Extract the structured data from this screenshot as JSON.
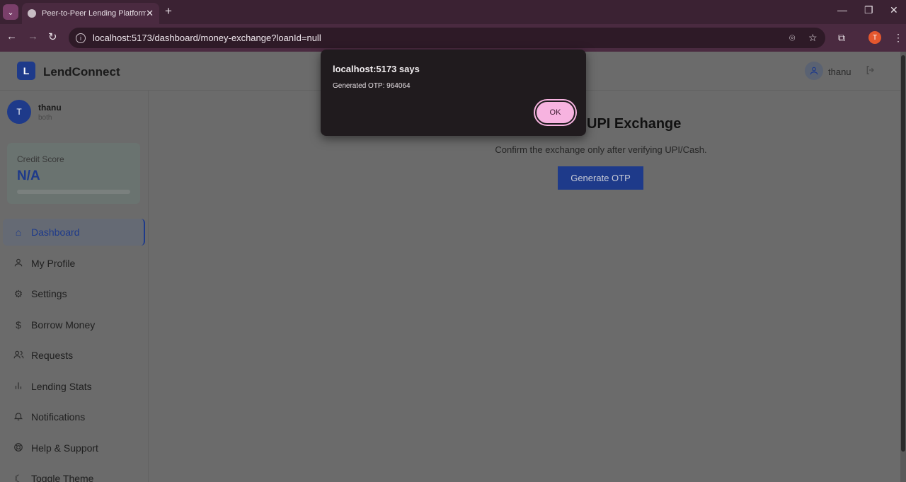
{
  "browser": {
    "tab_title": "Peer-to-Peer Lending Platform",
    "url": "localhost:5173/dashboard/money-exchange?loanId=null",
    "profile_initial": "T"
  },
  "header": {
    "logo_letter": "L",
    "brand": "LendConnect",
    "user_name": "thanu"
  },
  "sidebar": {
    "avatar_initial": "T",
    "user_name": "thanu",
    "user_role": "both",
    "credit_label": "Credit Score",
    "credit_value": "N/A",
    "items": [
      {
        "label": "Dashboard",
        "icon": "home-icon"
      },
      {
        "label": "My Profile",
        "icon": "user-icon"
      },
      {
        "label": "Settings",
        "icon": "gear-icon"
      },
      {
        "label": "Borrow Money",
        "icon": "dollar-icon"
      },
      {
        "label": "Requests",
        "icon": "users-icon"
      },
      {
        "label": "Lending Stats",
        "icon": "bar-chart-icon"
      },
      {
        "label": "Notifications",
        "icon": "bell-icon"
      },
      {
        "label": "Help & Support",
        "icon": "lifebuoy-icon"
      },
      {
        "label": "Toggle Theme",
        "icon": "moon-icon"
      }
    ]
  },
  "main": {
    "title": "UPI Exchange",
    "subtitle": "Confirm the exchange only after verifying UPI/Cash.",
    "generate_otp_label": "Generate OTP"
  },
  "dialog": {
    "title": "localhost:5173 says",
    "message": "Generated OTP: 964064",
    "ok_label": "OK"
  },
  "colors": {
    "brand": "#1e3a8a",
    "ok_button": "#f7b3e0"
  }
}
